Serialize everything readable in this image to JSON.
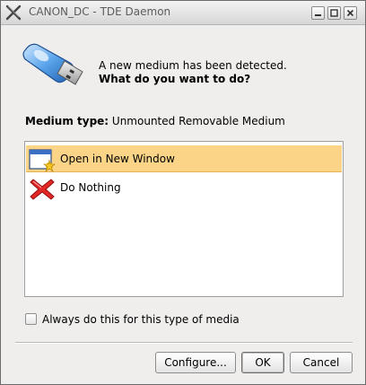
{
  "window": {
    "title": "CANON_DC - TDE Daemon"
  },
  "message": {
    "line1": "A new medium has been detected.",
    "line2": "What do you want to do?"
  },
  "medium": {
    "label": "Medium type:",
    "value": "Unmounted Removable Medium"
  },
  "actions": [
    {
      "label": "Open in New Window",
      "icon": "open-window-icon",
      "selected": true
    },
    {
      "label": "Do Nothing",
      "icon": "cancel-x-icon",
      "selected": false
    }
  ],
  "always": {
    "label": "Always do this for this type of media",
    "checked": false
  },
  "buttons": {
    "configure": "Configure...",
    "ok": "OK",
    "cancel": "Cancel"
  },
  "colors": {
    "selection": "#fbd487",
    "list_bg": "#ffffff",
    "dialog_bg": "#efeeed"
  }
}
